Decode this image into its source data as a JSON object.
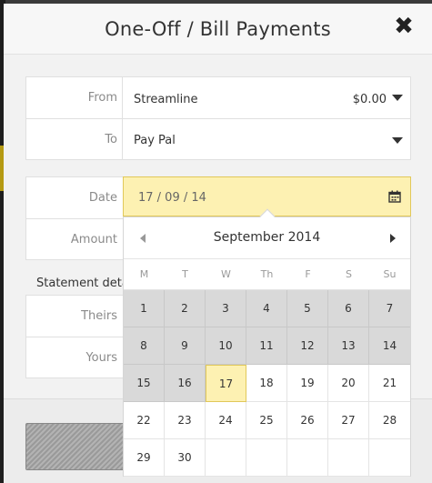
{
  "modal": {
    "title": "One-Off / Bill Payments",
    "close_glyph": "✖"
  },
  "form": {
    "from": {
      "label": "From",
      "value": "Streamline",
      "amount": "$0.00"
    },
    "to": {
      "label": "To",
      "value": "Pay Pal"
    },
    "date": {
      "label": "Date",
      "value": "17 / 09 / 14"
    },
    "amount": {
      "label": "Amount"
    },
    "statement": {
      "heading": "Statement deta",
      "theirs_label": "Theirs",
      "yours_label": "Yours"
    }
  },
  "calendar": {
    "month_label": "September 2014",
    "weekdays": [
      "M",
      "T",
      "W",
      "Th",
      "F",
      "S",
      "Su"
    ],
    "selected_day": 17,
    "days": [
      [
        "1",
        "2",
        "3",
        "4",
        "5",
        "6",
        "7"
      ],
      [
        "8",
        "9",
        "10",
        "11",
        "12",
        "13",
        "14"
      ],
      [
        "15",
        "16",
        "17",
        "18",
        "19",
        "20",
        "21"
      ],
      [
        "22",
        "23",
        "24",
        "25",
        "26",
        "27",
        "28"
      ],
      [
        "29",
        "30",
        "",
        "",
        "",
        "",
        ""
      ]
    ],
    "past_through": 16
  },
  "colors": {
    "accent_yellow": "#fdf1b2",
    "accent_border": "#e1c85a",
    "past_day_bg": "#d9d9d9"
  }
}
